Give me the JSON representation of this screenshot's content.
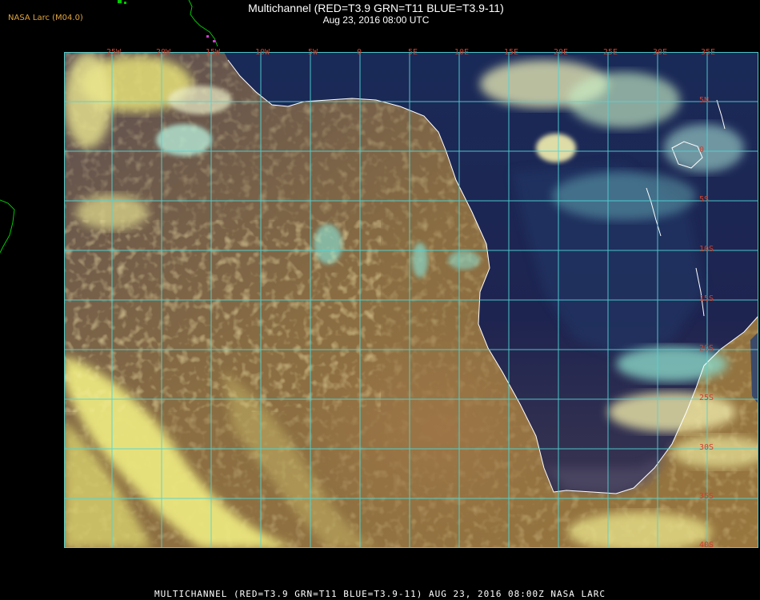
{
  "header": {
    "credit": "NASA Larc (M04.0)",
    "title": "Multichannel (RED=T3.9 GRN=T11 BLUE=T3.9-11)",
    "datetime": "Aug 23, 2016 08:00 UTC"
  },
  "footer": {
    "caption": "MULTICHANNEL (RED=T3.9 GRN=T11 BLUE=T3.9-11) AUG 23, 2016 08:00Z   NASA LARC"
  },
  "map": {
    "lon_labels": [
      "25W",
      "20W",
      "15W",
      "10W",
      "5W",
      "0",
      "5E",
      "10E",
      "15E",
      "20E",
      "25E",
      "30E",
      "35E"
    ],
    "lat_labels": [
      "5N",
      "0",
      "5S",
      "10S",
      "15S",
      "20S",
      "25S",
      "30S",
      "35S",
      "40S"
    ],
    "colors": {
      "grid": "#4fd6d6",
      "coast": "#ffffff",
      "labels": "#d0402c",
      "ocean_base": "#8a6a3a",
      "land_base": "#1c2550",
      "cloud": "#e8e07a",
      "cirrus": "#7fd8c8"
    }
  }
}
